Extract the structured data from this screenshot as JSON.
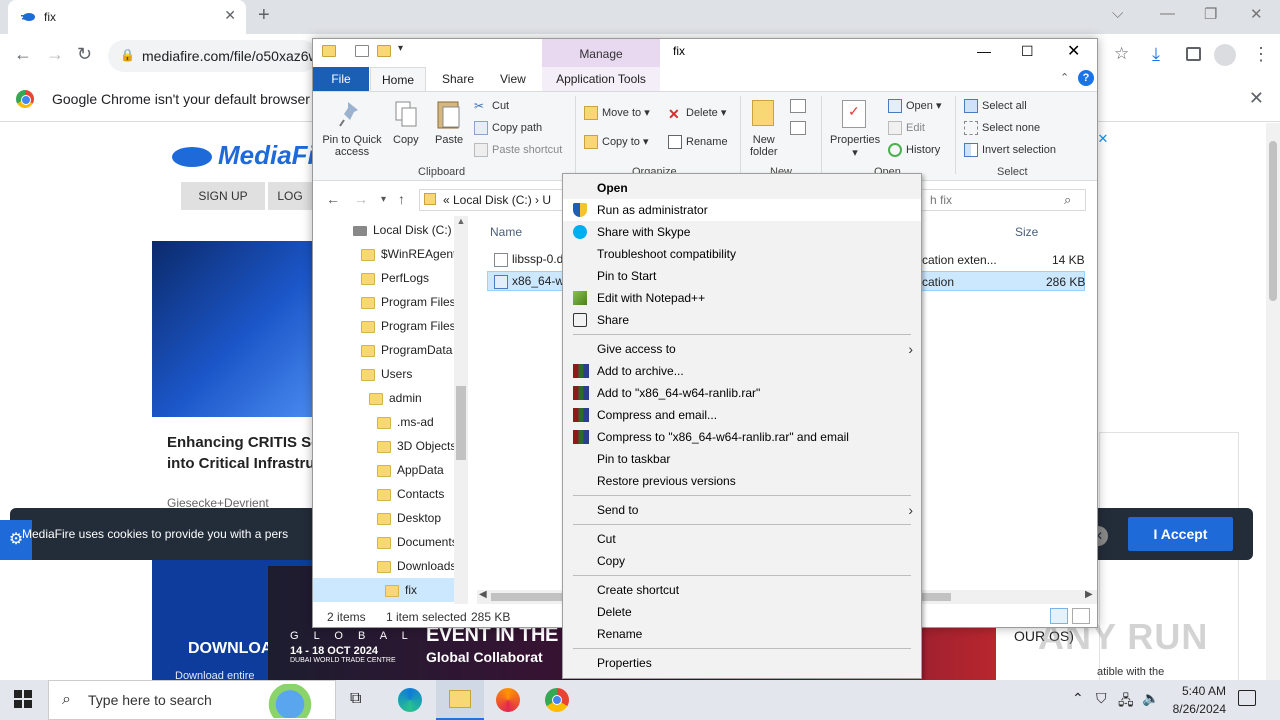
{
  "chrome": {
    "tab_title": "fix",
    "tab_close": "✕",
    "new_tab": "+",
    "url": "mediafire.com/file/o50xaz6w",
    "infobar_message": "Google Chrome isn't your default browser",
    "infobar_close": "✕",
    "window_controls": [
      "⌵",
      "—",
      "❐",
      "✕"
    ]
  },
  "page": {
    "logo": "MediaFi",
    "signup": "SIGN UP",
    "login": "LOG",
    "article_title_1": "Enhancing CRITIS Se",
    "article_title_2": "into Critical Infrastru",
    "article_meta": "Giesecke+Devrient",
    "cookie_text": "MediaFire uses cookies to provide you with a pers",
    "accept": "I Accept",
    "cookie_close": "✕",
    "ad_close": "✕",
    "download_label": "DOWNLOA",
    "download_sub": "Download entire",
    "banner_global": "G L O B A L",
    "banner_date": "14 - 18 OCT 2024",
    "banner_venue": "DUBAI WORLD TRADE CENTRE",
    "banner_event": "EVENT IN THE",
    "banner_collab": "Global Collaborat",
    "banner_right": "OUR OS)",
    "right_card_text": "atible with the",
    "watermark": "ANY RUN"
  },
  "explorer": {
    "title": "fix",
    "manage": "Manage",
    "tabs": {
      "file": "File",
      "home": "Home",
      "share": "Share",
      "view": "View",
      "app_tools": "Application Tools"
    },
    "clipboard": {
      "pin": "Pin to Quick",
      "pin2": "access",
      "copy": "Copy",
      "paste": "Paste",
      "cut": "Cut",
      "copy_path": "Copy path",
      "paste_shortcut": "Paste shortcut",
      "group": "Clipboard"
    },
    "organize": {
      "move_to": "Move to",
      "copy_to": "Copy to",
      "delete": "Delete",
      "rename": "Rename",
      "group": "Organize"
    },
    "new": {
      "new_folder": "New",
      "new_folder2": "folder",
      "group": "New"
    },
    "open": {
      "properties": "Properties",
      "open": "Open",
      "edit": "Edit",
      "history": "History",
      "group": "Open"
    },
    "select": {
      "select_all": "Select all",
      "select_none": "Select none",
      "invert": "Invert selection",
      "group": "Select"
    },
    "address": "«  Local Disk (C:)  ›  U",
    "search": "h fix",
    "tree": [
      {
        "label": "Local Disk (C:)",
        "indent": 0
      },
      {
        "label": "$WinREAgent",
        "indent": 1
      },
      {
        "label": "PerfLogs",
        "indent": 1
      },
      {
        "label": "Program Files",
        "indent": 1
      },
      {
        "label": "Program Files",
        "indent": 1
      },
      {
        "label": "ProgramData",
        "indent": 1
      },
      {
        "label": "Users",
        "indent": 1
      },
      {
        "label": "admin",
        "indent": 2
      },
      {
        "label": ".ms-ad",
        "indent": 3
      },
      {
        "label": "3D Objects",
        "indent": 3
      },
      {
        "label": "AppData",
        "indent": 3
      },
      {
        "label": "Contacts",
        "indent": 3
      },
      {
        "label": "Desktop",
        "indent": 3
      },
      {
        "label": "Documents",
        "indent": 3
      },
      {
        "label": "Downloads",
        "indent": 3
      },
      {
        "label": "fix",
        "indent": 4
      }
    ],
    "columns": {
      "name": "Name",
      "size": "Size"
    },
    "files": [
      {
        "name": "libssp-0.d",
        "type": "cation exten...",
        "size": "14 KB"
      },
      {
        "name": "x86_64-w",
        "type": "cation",
        "size": "286 KB"
      }
    ],
    "status": {
      "items": "2 items",
      "selected": "1 item selected",
      "size": "285 KB"
    }
  },
  "context_menu": [
    {
      "label": "Open",
      "bold": true
    },
    {
      "label": "Run as administrator",
      "icon": "uac-shield-icon",
      "highlight": true
    },
    {
      "label": "Share with Skype",
      "icon": "skype-icon"
    },
    {
      "label": "Troubleshoot compatibility"
    },
    {
      "label": "Pin to Start"
    },
    {
      "label": "Edit with Notepad++",
      "icon": "notepadpp-icon"
    },
    {
      "label": "Share",
      "icon": "share-icon"
    },
    {
      "sep": true
    },
    {
      "label": "Give access to",
      "submenu": true
    },
    {
      "label": "Add to archive...",
      "icon": "winrar-icon"
    },
    {
      "label": "Add to \"x86_64-w64-ranlib.rar\"",
      "icon": "winrar-icon"
    },
    {
      "label": "Compress and email...",
      "icon": "winrar-icon"
    },
    {
      "label": "Compress to \"x86_64-w64-ranlib.rar\" and email",
      "icon": "winrar-icon"
    },
    {
      "label": "Pin to taskbar"
    },
    {
      "label": "Restore previous versions"
    },
    {
      "sep": true
    },
    {
      "label": "Send to",
      "submenu": true
    },
    {
      "sep": true
    },
    {
      "label": "Cut"
    },
    {
      "label": "Copy"
    },
    {
      "sep": true
    },
    {
      "label": "Create shortcut"
    },
    {
      "label": "Delete"
    },
    {
      "label": "Rename"
    },
    {
      "sep": true
    },
    {
      "label": "Properties"
    }
  ],
  "taskbar": {
    "search_placeholder": "Type here to search",
    "time": "5:40 AM",
    "date": "8/26/2024"
  },
  "colors": {
    "accent": "#1a5fb4",
    "selection": "#cce8ff",
    "mediafire_blue": "#1d6ad8"
  }
}
